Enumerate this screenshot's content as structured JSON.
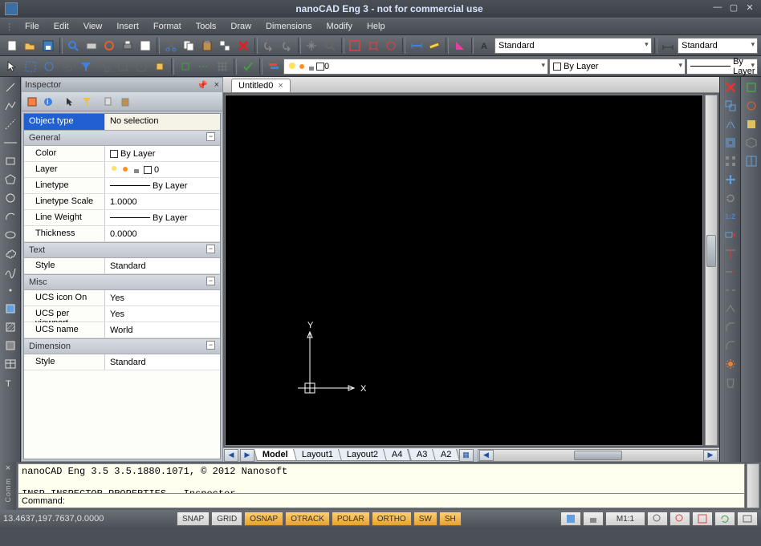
{
  "title": "nanoCAD Eng 3 - not for commercial use",
  "menu": [
    "File",
    "Edit",
    "View",
    "Insert",
    "Format",
    "Tools",
    "Draw",
    "Dimensions",
    "Modify",
    "Help"
  ],
  "textstyle_combo": "Standard",
  "dimstyle_combo": "Standard",
  "layer_combo": "0",
  "color_combo": "By Layer",
  "lt_combo": "By Layer",
  "inspector": {
    "title": "Inspector",
    "header_key": "Object type",
    "header_val": "No selection",
    "cats": {
      "general": "General",
      "text": "Text",
      "misc": "Misc",
      "dimension": "Dimension"
    },
    "rows": {
      "color": {
        "k": "Color",
        "v": "By Layer"
      },
      "layer": {
        "k": "Layer",
        "v": "0"
      },
      "linetype": {
        "k": "Linetype",
        "v": "By Layer"
      },
      "ltscale": {
        "k": "Linetype Scale",
        "v": "1.0000"
      },
      "lweight": {
        "k": "Line Weight",
        "v": "By Layer"
      },
      "thickness": {
        "k": "Thickness",
        "v": "0.0000"
      },
      "textstyle": {
        "k": "Style",
        "v": "Standard"
      },
      "ucsicon": {
        "k": "UCS icon On",
        "v": "Yes"
      },
      "ucsvp": {
        "k": "UCS per viewport",
        "v": "Yes"
      },
      "ucsname": {
        "k": "UCS name",
        "v": "World"
      },
      "dimstyle": {
        "k": "Style",
        "v": "Standard"
      }
    }
  },
  "doc_tab": "Untitled0",
  "ucs_labels": {
    "x": "X",
    "y": "Y"
  },
  "layout_tabs": [
    "Model",
    "Layout1",
    "Layout2",
    "A4",
    "A3",
    "A2"
  ],
  "cmd_log": "nanoCAD Eng 3.5 3.5.1880.1071, © 2012 Nanosoft\n\nINSP,INSPECTOR,PROPERTIES - Inspector",
  "cmd_prompt": "Command:",
  "status": {
    "coords": "13.4637,197.7637,0.0000",
    "toggles": {
      "snap": "SNAP",
      "grid": "GRID",
      "osnap": "OSNAP",
      "otrack": "OTRACK",
      "polar": "POLAR",
      "ortho": "ORTHO",
      "sw": "SW",
      "sh": "SH"
    },
    "scale": "M1:1",
    "right_scale_label": "1:2"
  },
  "colors": {
    "accent": "#2060d0",
    "canvas": "#000000",
    "panel": "#bfc5cc"
  }
}
